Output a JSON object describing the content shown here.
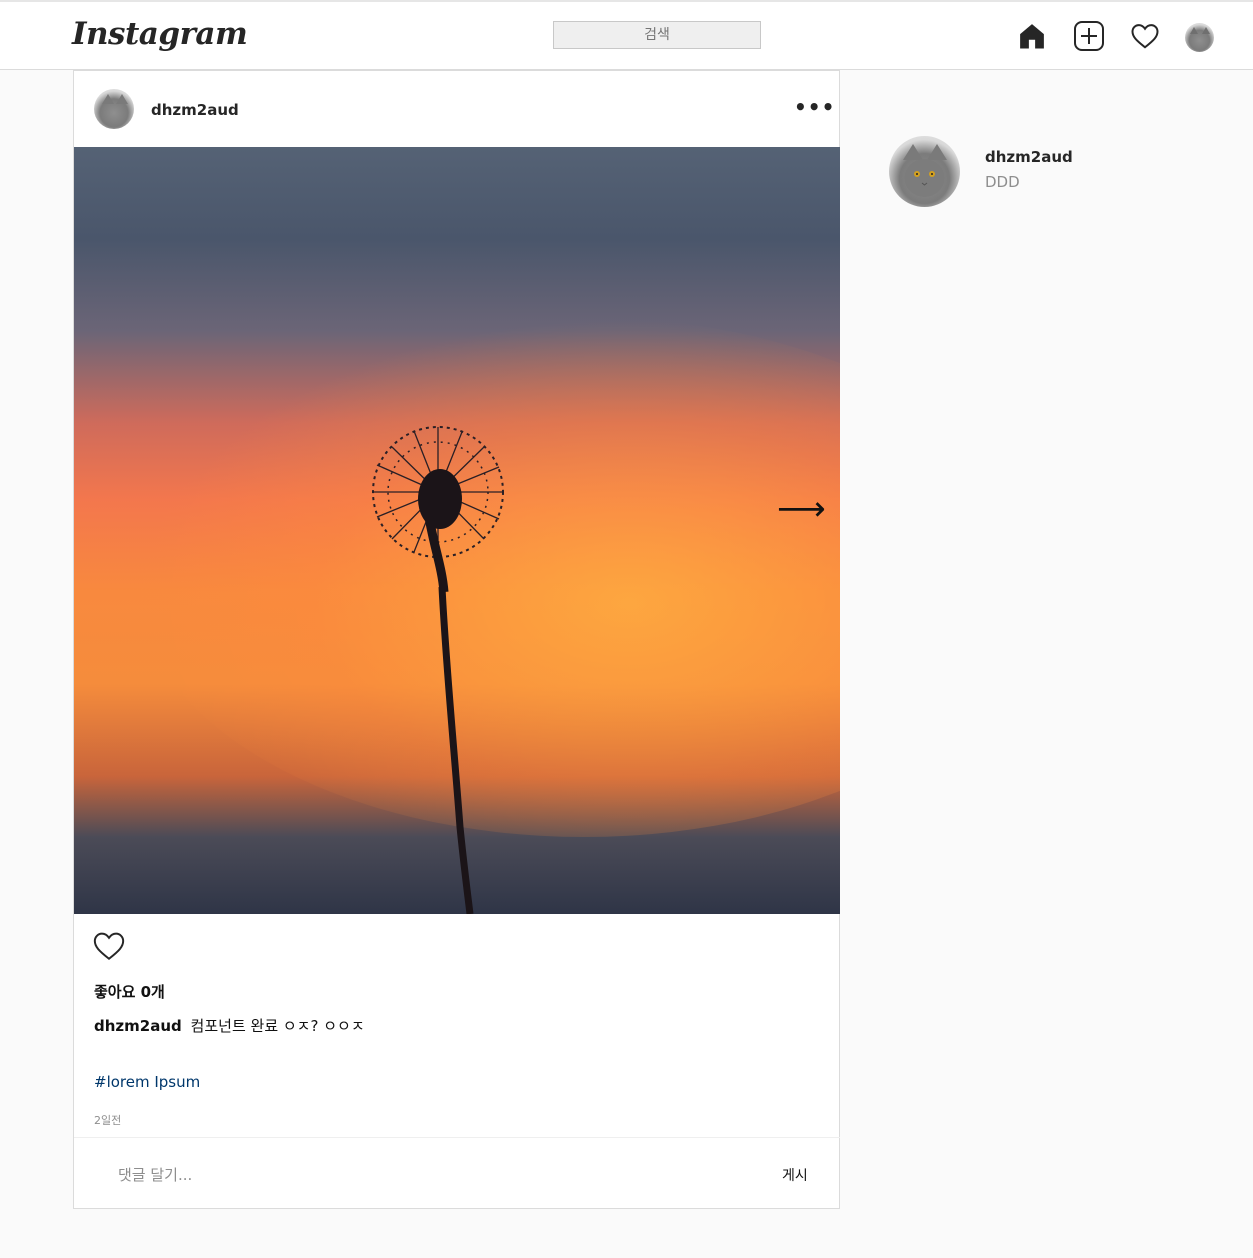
{
  "header": {
    "logo": "Instagram",
    "search_placeholder": "검색",
    "icons": [
      "home-icon",
      "add-post-icon",
      "heart-icon",
      "profile-avatar"
    ]
  },
  "post": {
    "username": "dhzm2aud",
    "more": "•••",
    "image_alt": "dandelion silhouette at sunset",
    "next_arrow": "⟶",
    "likes": "좋아요 0개",
    "caption_user": "dhzm2aud",
    "caption_text": "컴포넌트 완료 ㅇㅈ? ㅇㅇㅈ",
    "hashtag": "#lorem Ipsum",
    "time": "2일전",
    "comment_placeholder": "댓글 달기...",
    "post_button": "게시"
  },
  "sidebar": {
    "username": "dhzm2aud",
    "name": "DDD"
  },
  "colors": {
    "background": "#fafafa",
    "border": "#dbdbdb",
    "hashtag": "#00376b",
    "secondary_text": "#8e8e8e"
  }
}
